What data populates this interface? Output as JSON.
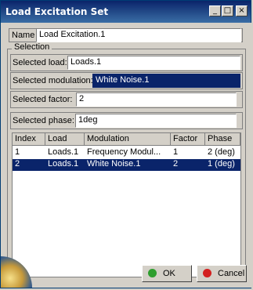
{
  "window": {
    "title": "Load Excitation Set"
  },
  "titlebar_buttons": {
    "minimize": "_",
    "maximize": "□",
    "close": "×"
  },
  "name": {
    "label": "Name",
    "value": "Load Excitation.1"
  },
  "selection": {
    "group_label": "Selection",
    "load": {
      "label": "Selected load:",
      "value": "Loads.1"
    },
    "modulation": {
      "label": "Selected modulation:",
      "value": "White Noise.1"
    },
    "factor": {
      "label": "Selected factor:",
      "value": "2"
    },
    "phase": {
      "label": "Selected phase:",
      "value": "1deg"
    }
  },
  "table": {
    "headers": [
      "Index",
      "Load",
      "Modulation",
      "Factor",
      "Phase"
    ],
    "rows": [
      {
        "index": "1",
        "load": "Loads.1",
        "modulation": "Frequency Modul...",
        "factor": "1",
        "phase": "2 (deg)"
      },
      {
        "index": "2",
        "load": "Loads.1",
        "modulation": "White Noise.1",
        "factor": "2",
        "phase": "1 (deg)"
      }
    ]
  },
  "buttons": {
    "ok": "OK",
    "cancel": "Cancel"
  },
  "colors": {
    "ok_dot": "#2e9e2e",
    "cancel_dot": "#d32020",
    "selection": "#0a246a"
  }
}
